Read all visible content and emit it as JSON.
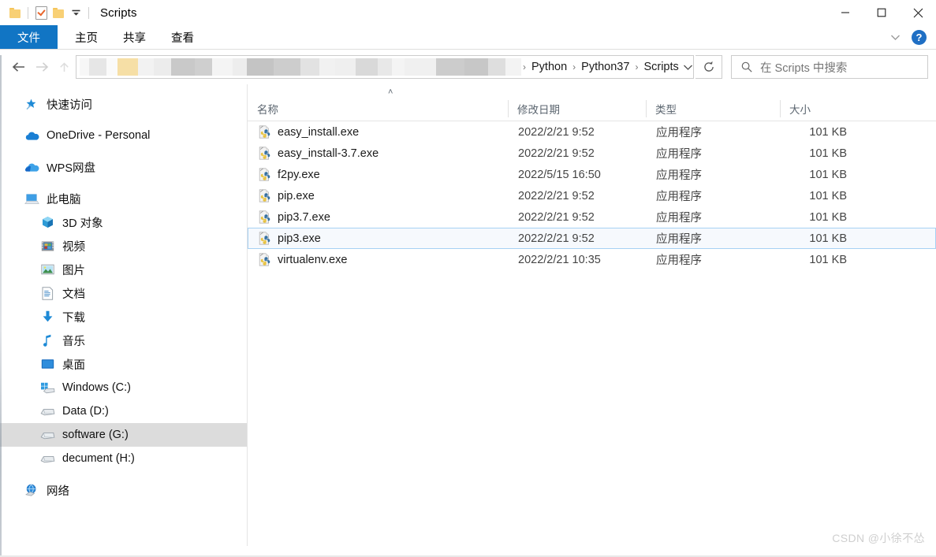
{
  "window": {
    "title": "Scripts",
    "quick_access": [
      {
        "name": "folder-icon",
        "label": "文件夹"
      },
      {
        "name": "properties-icon",
        "label": "属性"
      },
      {
        "name": "new-folder-icon",
        "label": "新建文件夹"
      }
    ],
    "dropdown_label": "▾",
    "controls": {
      "minimize": "—",
      "maximize": "□",
      "close": "✕"
    }
  },
  "ribbon": {
    "tabs": [
      {
        "label": "文件",
        "active": true
      },
      {
        "label": "主页",
        "active": false
      },
      {
        "label": "共享",
        "active": false
      },
      {
        "label": "查看",
        "active": false
      }
    ],
    "collapse_label": "⌄",
    "help_label": "?"
  },
  "addressbar": {
    "back_label": "←",
    "forward_label": "→",
    "up_label": "↑",
    "redacted": true,
    "breadcrumbs": [
      "Python",
      "Python37",
      "Scripts"
    ],
    "separator": "›",
    "dropdown_label": "⌄",
    "refresh_label": "↻"
  },
  "search": {
    "placeholder": "在 Scripts 中搜索",
    "value": "",
    "icon": "search-icon"
  },
  "sidebar": {
    "items": [
      {
        "label": "快速访问",
        "icon": "star-pin-icon",
        "level": 0,
        "selected": false,
        "gap_after": true
      },
      {
        "label": "OneDrive - Personal",
        "icon": "onedrive-cloud-icon",
        "level": 0,
        "selected": false,
        "gap_after": true
      },
      {
        "label": "WPS网盘",
        "icon": "wps-cloud-icon",
        "level": 0,
        "selected": false,
        "gap_after": true
      },
      {
        "label": "此电脑",
        "icon": "this-pc-icon",
        "level": 0,
        "selected": false,
        "gap_after": false
      },
      {
        "label": "3D 对象",
        "icon": "3d-objects-icon",
        "level": 1,
        "selected": false,
        "gap_after": false
      },
      {
        "label": "视频",
        "icon": "videos-icon",
        "level": 1,
        "selected": false,
        "gap_after": false
      },
      {
        "label": "图片",
        "icon": "pictures-icon",
        "level": 1,
        "selected": false,
        "gap_after": false
      },
      {
        "label": "文档",
        "icon": "documents-icon",
        "level": 1,
        "selected": false,
        "gap_after": false
      },
      {
        "label": "下载",
        "icon": "downloads-icon",
        "level": 1,
        "selected": false,
        "gap_after": false
      },
      {
        "label": "音乐",
        "icon": "music-icon",
        "level": 1,
        "selected": false,
        "gap_after": false
      },
      {
        "label": "桌面",
        "icon": "desktop-icon",
        "level": 1,
        "selected": false,
        "gap_after": false
      },
      {
        "label": "Windows (C:)",
        "icon": "windows-drive-icon",
        "level": 1,
        "selected": false,
        "gap_after": false
      },
      {
        "label": "Data (D:)",
        "icon": "drive-icon",
        "level": 1,
        "selected": false,
        "gap_after": false
      },
      {
        "label": "software (G:)",
        "icon": "drive-icon",
        "level": 1,
        "selected": true,
        "gap_after": false
      },
      {
        "label": "decument (H:)",
        "icon": "drive-icon",
        "level": 1,
        "selected": false,
        "gap_after": true
      },
      {
        "label": "网络",
        "icon": "network-icon",
        "level": 0,
        "selected": false,
        "gap_after": false
      }
    ]
  },
  "filelist": {
    "columns": [
      {
        "key": "name",
        "label": "名称",
        "sorted": "asc"
      },
      {
        "key": "date",
        "label": "修改日期",
        "sorted": null
      },
      {
        "key": "type",
        "label": "类型",
        "sorted": null
      },
      {
        "key": "size",
        "label": "大小",
        "sorted": null
      }
    ],
    "sort_caret": "˄",
    "rows": [
      {
        "name": "easy_install.exe",
        "date": "2022/2/21 9:52",
        "type": "应用程序",
        "size": "101 KB",
        "icon": "python-exe-icon",
        "selected": false
      },
      {
        "name": "easy_install-3.7.exe",
        "date": "2022/2/21 9:52",
        "type": "应用程序",
        "size": "101 KB",
        "icon": "python-exe-icon",
        "selected": false
      },
      {
        "name": "f2py.exe",
        "date": "2022/5/15 16:50",
        "type": "应用程序",
        "size": "101 KB",
        "icon": "python-exe-icon",
        "selected": false
      },
      {
        "name": "pip.exe",
        "date": "2022/2/21 9:52",
        "type": "应用程序",
        "size": "101 KB",
        "icon": "python-exe-icon",
        "selected": false
      },
      {
        "name": "pip3.7.exe",
        "date": "2022/2/21 9:52",
        "type": "应用程序",
        "size": "101 KB",
        "icon": "python-exe-icon",
        "selected": false
      },
      {
        "name": "pip3.exe",
        "date": "2022/2/21 9:52",
        "type": "应用程序",
        "size": "101 KB",
        "icon": "python-exe-icon",
        "selected": true
      },
      {
        "name": "virtualenv.exe",
        "date": "2022/2/21 10:35",
        "type": "应用程序",
        "size": "101 KB",
        "icon": "python-exe-icon",
        "selected": false
      }
    ]
  },
  "watermark": {
    "text": "CSDN @小徐不怂"
  },
  "colors": {
    "accent": "#1175c4",
    "selection_border": "#a6d1f4",
    "selection_fill": "#f6f9fd",
    "sidebar_selected": "#dcdcdc",
    "header_text": "#5c6670"
  }
}
